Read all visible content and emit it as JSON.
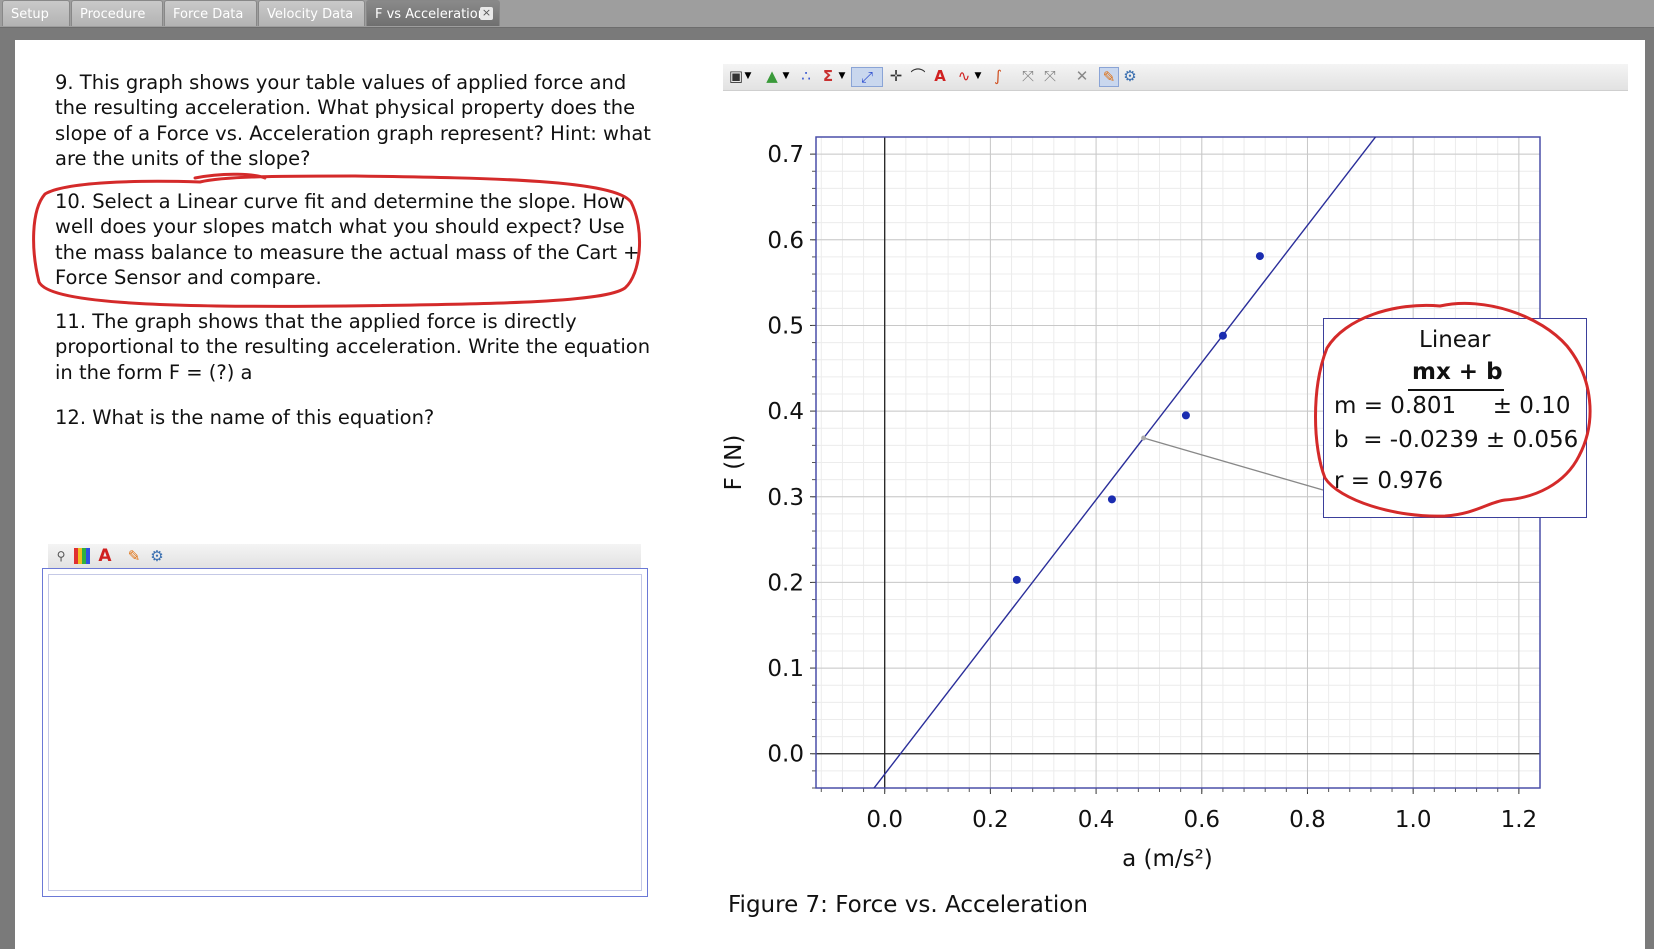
{
  "tabs": [
    {
      "label": "Setup"
    },
    {
      "label": "Procedure"
    },
    {
      "label": "Force Data"
    },
    {
      "label": "Velocity Data"
    },
    {
      "label": "F vs Acceleration",
      "close": "×"
    }
  ],
  "questions": {
    "q9": "9.  This graph shows your table values of applied force and the resulting acceleration.  What physical property does the slope of a Force vs. Acceleration graph represent?  Hint: what are the units of the slope?",
    "q10": "10.  Select a Linear curve fit and determine the slope. How well does your slopes match what you should expect?  Use the mass balance to measure the actual mass of the Cart + Force Sensor and compare.",
    "q11": "11.  The graph shows that the applied force is directly proportional to the resulting acceleration. Write the equation in the form    F = (?) a",
    "q12": "12.  What is the name of this equation?"
  },
  "answer": {
    "text": ""
  },
  "figure_caption": "Figure 7: Force vs. Acceleration",
  "curve_fit": {
    "title": "Linear",
    "equation": "mx + b",
    "m_line": "m = 0.801     ± 0.10",
    "b_line": "b  = -0.0239 ± 0.056",
    "r_line": "r = 0.976"
  },
  "colors": {
    "fit_line": "#2a2e9a",
    "points": "#1a2cb0",
    "annotation": "#d42a2a",
    "grid_major": "#c8c8c8",
    "grid_minor": "#ececec"
  },
  "chart_data": {
    "type": "scatter",
    "xlabel": "a (m/s²)",
    "ylabel": "F (N)",
    "xlim": [
      -0.13,
      1.24
    ],
    "ylim": [
      -0.04,
      0.72
    ],
    "x_ticks": [
      "0.0",
      "0.2",
      "0.4",
      "0.6",
      "0.8",
      "1.0",
      "1.2"
    ],
    "y_ticks": [
      "0.0",
      "0.1",
      "0.2",
      "0.3",
      "0.4",
      "0.5",
      "0.6",
      "0.7"
    ],
    "grid": true,
    "series": [
      {
        "x": [
          0.25,
          0.43,
          0.57,
          0.64,
          0.71
        ],
        "y": [
          0.203,
          0.297,
          0.395,
          0.488,
          0.581
        ]
      }
    ],
    "fit": {
      "type": "linear",
      "m": 0.801,
      "b": -0.0239,
      "r": 0.976
    }
  }
}
